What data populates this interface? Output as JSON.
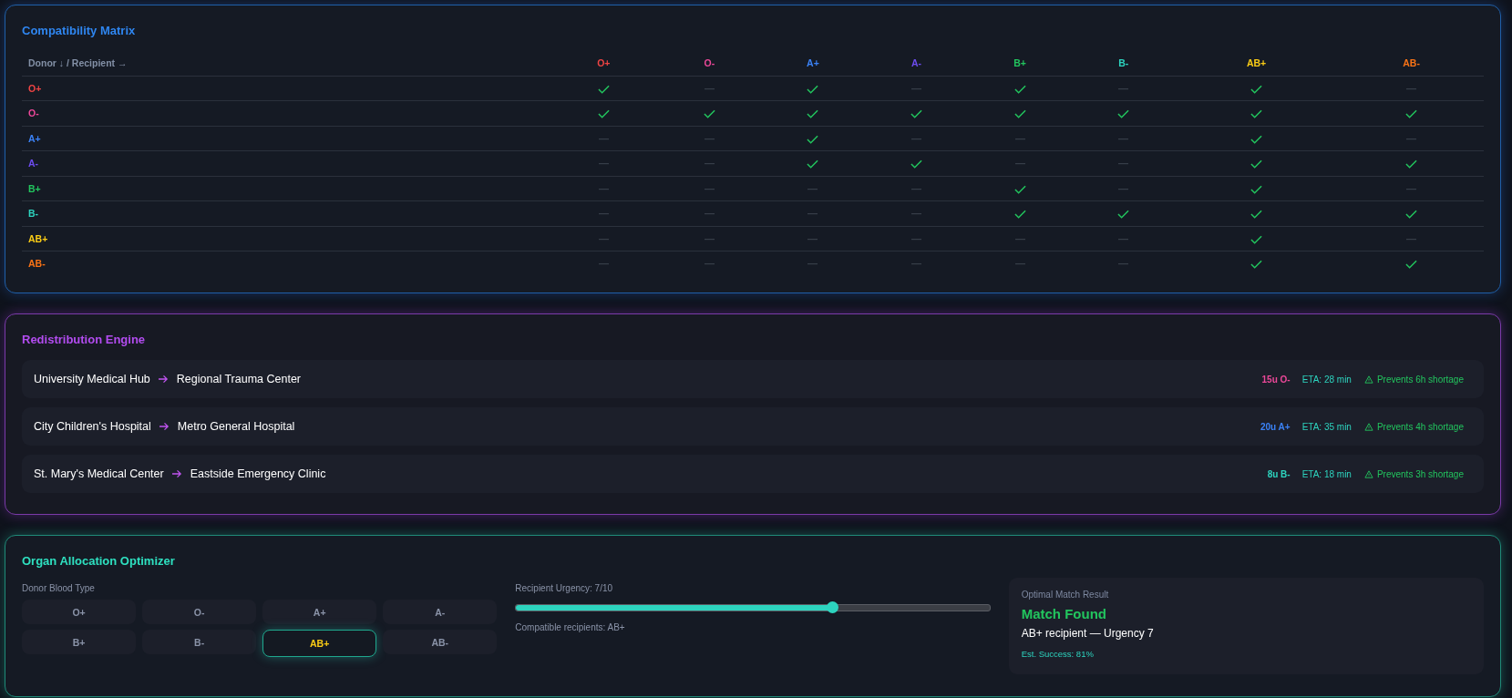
{
  "compatibility_matrix": {
    "title": "Compatibility Matrix",
    "corner_label": "Donor ↓ / Recipient →",
    "columns": [
      {
        "label": "O+",
        "color": "#ef4444"
      },
      {
        "label": "O-",
        "color": "#ec4899"
      },
      {
        "label": "A+",
        "color": "#3b82f6"
      },
      {
        "label": "A-",
        "color": "#6d4cf0"
      },
      {
        "label": "B+",
        "color": "#22c55e"
      },
      {
        "label": "B-",
        "color": "#2dd4bf"
      },
      {
        "label": "AB+",
        "color": "#facc15"
      },
      {
        "label": "AB-",
        "color": "#f97316"
      }
    ],
    "rows": [
      {
        "label": "O+",
        "color": "#ef4444",
        "compatible": [
          true,
          false,
          true,
          false,
          true,
          false,
          true,
          false
        ]
      },
      {
        "label": "O-",
        "color": "#ec4899",
        "compatible": [
          true,
          true,
          true,
          true,
          true,
          true,
          true,
          true
        ]
      },
      {
        "label": "A+",
        "color": "#3b82f6",
        "compatible": [
          false,
          false,
          true,
          false,
          false,
          false,
          true,
          false
        ]
      },
      {
        "label": "A-",
        "color": "#6d4cf0",
        "compatible": [
          false,
          false,
          true,
          true,
          false,
          false,
          true,
          true
        ]
      },
      {
        "label": "B+",
        "color": "#22c55e",
        "compatible": [
          false,
          false,
          false,
          false,
          true,
          false,
          true,
          false
        ]
      },
      {
        "label": "B-",
        "color": "#2dd4bf",
        "compatible": [
          false,
          false,
          false,
          false,
          true,
          true,
          true,
          true
        ]
      },
      {
        "label": "AB+",
        "color": "#facc15",
        "compatible": [
          false,
          false,
          false,
          false,
          false,
          false,
          true,
          false
        ]
      },
      {
        "label": "AB-",
        "color": "#f97316",
        "compatible": [
          false,
          false,
          false,
          false,
          false,
          false,
          true,
          true
        ]
      }
    ]
  },
  "redistribution_engine": {
    "title": "Redistribution Engine",
    "routes": [
      {
        "from": "University Medical Hub",
        "to": "Regional Trauma Center",
        "units": "15u O-",
        "color": "#ec4899",
        "eta": "ETA: 28 min",
        "note": "Prevents 6h shortage"
      },
      {
        "from": "City Children's Hospital",
        "to": "Metro General Hospital",
        "units": "20u A+",
        "color": "#3b82f6",
        "eta": "ETA: 35 min",
        "note": "Prevents 4h shortage"
      },
      {
        "from": "St. Mary's Medical Center",
        "to": "Eastside Emergency Clinic",
        "units": "8u B-",
        "color": "#2dd4bf",
        "eta": "ETA: 18 min",
        "note": "Prevents 3h shortage"
      }
    ]
  },
  "organ_allocation_optimizer": {
    "title": "Organ Allocation Optimizer",
    "donor_label": "Donor Blood Type",
    "donor_types": [
      {
        "label": "O+",
        "selected": false
      },
      {
        "label": "O-",
        "selected": false
      },
      {
        "label": "A+",
        "selected": false
      },
      {
        "label": "A-",
        "selected": false
      },
      {
        "label": "B+",
        "selected": false
      },
      {
        "label": "B-",
        "selected": false
      },
      {
        "label": "AB+",
        "selected": true
      },
      {
        "label": "AB-",
        "selected": false
      }
    ],
    "urgency": {
      "label": "Recipient Urgency: 7/10",
      "level": 0.667
    },
    "compatible_recipients": "Compatible recipients: AB+",
    "result": {
      "heading": "Optimal Match Result",
      "status": "Match Found",
      "detail": "AB+ recipient — Urgency 7",
      "success": "Est. Success: 81%"
    }
  }
}
